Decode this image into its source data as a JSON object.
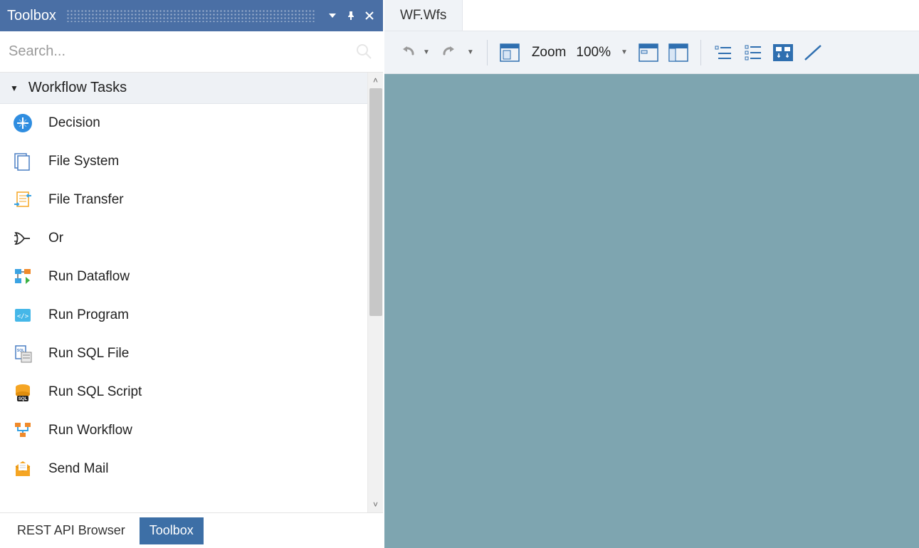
{
  "panel": {
    "title": "Toolbox",
    "search_placeholder": "Search...",
    "group_title": "Workflow Tasks",
    "tasks": [
      {
        "label": "Decision",
        "icon": "decision"
      },
      {
        "label": "File System",
        "icon": "filesystem"
      },
      {
        "label": "File Transfer",
        "icon": "filetransfer"
      },
      {
        "label": "Or",
        "icon": "or"
      },
      {
        "label": "Run Dataflow",
        "icon": "dataflow"
      },
      {
        "label": "Run Program",
        "icon": "program"
      },
      {
        "label": "Run SQL File",
        "icon": "sqlfile"
      },
      {
        "label": "Run SQL Script",
        "icon": "sqlscript"
      },
      {
        "label": "Run Workflow",
        "icon": "workflow"
      },
      {
        "label": "Send Mail",
        "icon": "mail"
      }
    ],
    "bottom_tabs": {
      "rest_api": "REST API Browser",
      "toolbox": "Toolbox",
      "active": "toolbox"
    }
  },
  "document": {
    "tab_title": "WF.Wfs"
  },
  "toolbar": {
    "zoom_label": "Zoom",
    "zoom_value": "100%"
  }
}
